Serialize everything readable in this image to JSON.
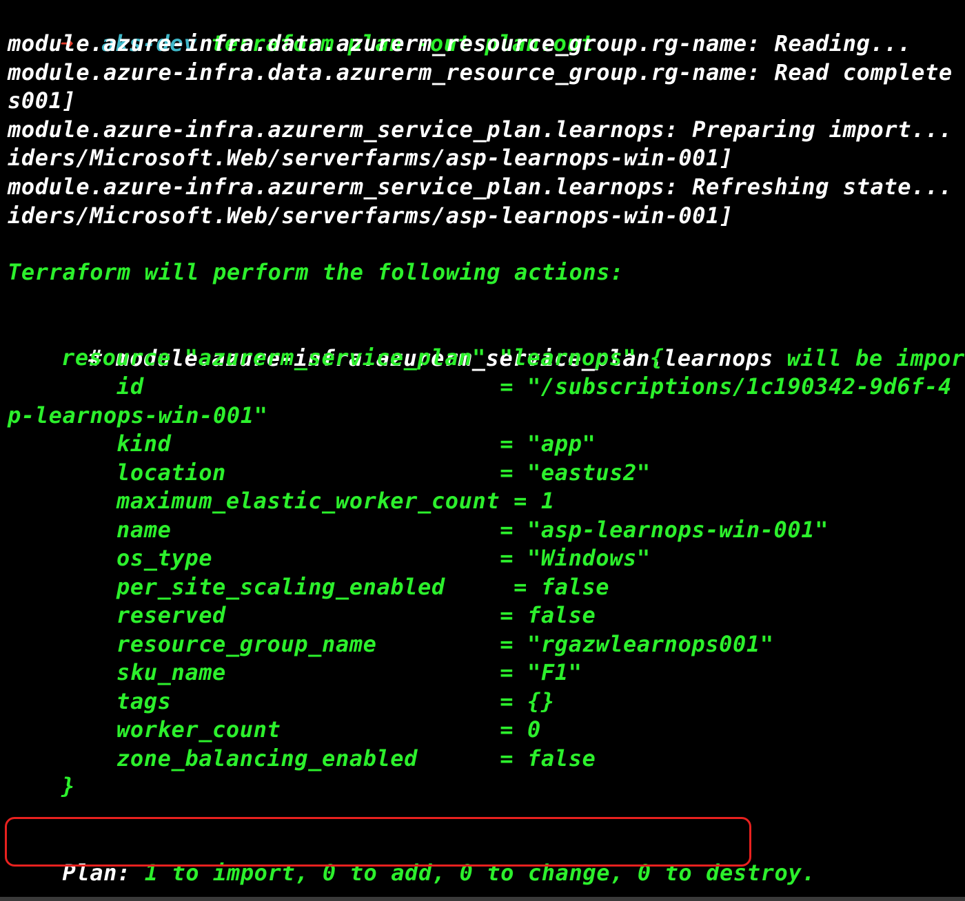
{
  "colors": {
    "background": "#000000",
    "text_white": "#ffffff",
    "text_green": "#2cf02c",
    "prompt_cyan": "#3fb8c9",
    "prompt_arrow_red": "#e23a2a",
    "highlight_red": "#e8211f"
  },
  "prompt": {
    "icon": "arrow-right-icon",
    "arrow": "➜",
    "directory": "aks-dev",
    "command": "terraform plan -out plan.out"
  },
  "refresh_log": [
    "module.azure-infra.data.azurerm_resource_group.rg-name: Reading...",
    "module.azure-infra.data.azurerm_resource_group.rg-name: Read complete",
    "s001]",
    "module.azure-infra.azurerm_service_plan.learnops: Preparing import...",
    "iders/Microsoft.Web/serverfarms/asp-learnops-win-001]",
    "module.azure-infra.azurerm_service_plan.learnops: Refreshing state...",
    "iders/Microsoft.Web/serverfarms/asp-learnops-win-001]"
  ],
  "actions_header": "Terraform will perform the following actions:",
  "resource": {
    "comment_hash": "#",
    "address": "module.azure-infra.azurerm_service_plan.learnops",
    "action": "will be imported",
    "declaration": "resource \"azurerm_service_plan\" \"learnops\" {",
    "attributes": [
      {
        "key": "id",
        "pad": "                          ",
        "value": "= \"/subscriptions/1c190342-9d6f-4"
      },
      {
        "key": "",
        "pad": "",
        "value": "p-learnops-win-001\"",
        "continuation": true
      },
      {
        "key": "kind",
        "pad": "                        ",
        "value": "= \"app\""
      },
      {
        "key": "location",
        "pad": "                    ",
        "value": "= \"eastus2\""
      },
      {
        "key": "maximum_elastic_worker_count",
        "pad": " ",
        "value": "= 1"
      },
      {
        "key": "name",
        "pad": "                        ",
        "value": "= \"asp-learnops-win-001\""
      },
      {
        "key": "os_type",
        "pad": "                     ",
        "value": "= \"Windows\""
      },
      {
        "key": "per_site_scaling_enabled",
        "pad": "     ",
        "value": "= false"
      },
      {
        "key": "reserved",
        "pad": "                    ",
        "value": "= false"
      },
      {
        "key": "resource_group_name",
        "pad": "         ",
        "value": "= \"rgazwlearnops001\""
      },
      {
        "key": "sku_name",
        "pad": "                    ",
        "value": "= \"F1\""
      },
      {
        "key": "tags",
        "pad": "                        ",
        "value": "= {}"
      },
      {
        "key": "worker_count",
        "pad": "                ",
        "value": "= 0"
      },
      {
        "key": "zone_balancing_enabled",
        "pad": "      ",
        "value": "= false"
      }
    ],
    "closing_brace": "}"
  },
  "plan_summary": {
    "label": "Plan:",
    "text": " 1 to import, 0 to add, 0 to change, 0 to destroy."
  }
}
